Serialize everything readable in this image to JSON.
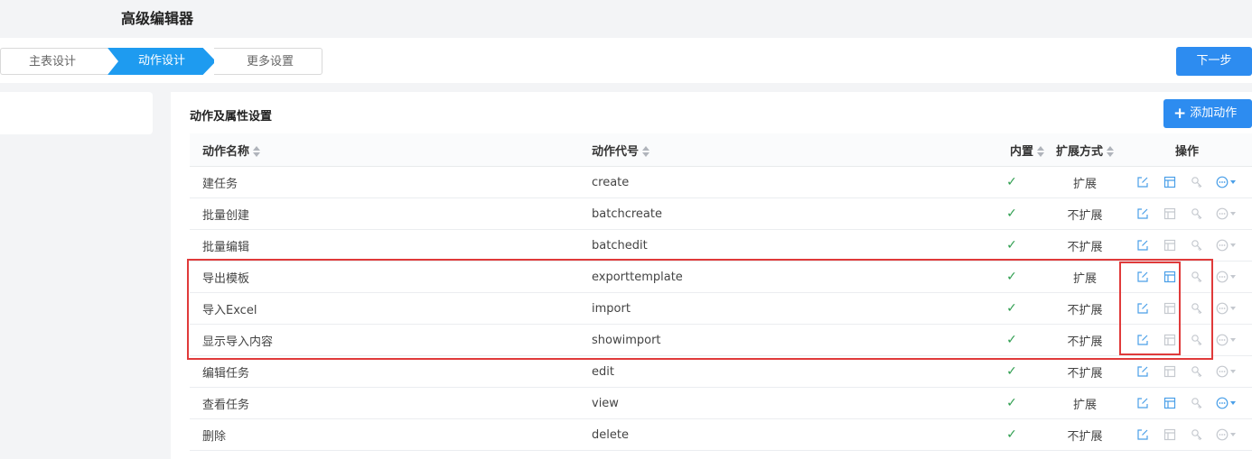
{
  "app_title": "高级编辑器",
  "steps": [
    "主表设计",
    "动作设计",
    "更多设置"
  ],
  "next_button": "下一步",
  "section_title": "动作及属性设置",
  "add_button": "添加动作",
  "columns": {
    "name": "动作名称",
    "code": "动作代号",
    "builtin": "内置",
    "ext": "扩展方式",
    "ops": "操作"
  },
  "rows": [
    {
      "name": "建任务",
      "code": "create",
      "builtin": "✓",
      "ext": "扩展",
      "edit_active": true,
      "layout_active": true,
      "more_active": true
    },
    {
      "name": "批量创建",
      "code": "batchcreate",
      "builtin": "✓",
      "ext": "不扩展",
      "edit_active": true,
      "layout_active": false,
      "more_active": false
    },
    {
      "name": "批量编辑",
      "code": "batchedit",
      "builtin": "✓",
      "ext": "不扩展",
      "edit_active": true,
      "layout_active": false,
      "more_active": false
    },
    {
      "name": "导出模板",
      "code": "exporttemplate",
      "builtin": "✓",
      "ext": "扩展",
      "edit_active": true,
      "layout_active": true,
      "more_active": false
    },
    {
      "name": "导入Excel",
      "code": "import",
      "builtin": "✓",
      "ext": "不扩展",
      "edit_active": true,
      "layout_active": false,
      "more_active": false
    },
    {
      "name": "显示导入内容",
      "code": "showimport",
      "builtin": "✓",
      "ext": "不扩展",
      "edit_active": true,
      "layout_active": false,
      "more_active": false
    },
    {
      "name": "编辑任务",
      "code": "edit",
      "builtin": "✓",
      "ext": "不扩展",
      "edit_active": true,
      "layout_active": false,
      "more_active": false
    },
    {
      "name": "查看任务",
      "code": "view",
      "builtin": "✓",
      "ext": "扩展",
      "edit_active": true,
      "layout_active": true,
      "more_active": true
    },
    {
      "name": "删除",
      "code": "delete",
      "builtin": "✓",
      "ext": "不扩展",
      "edit_active": true,
      "layout_active": false,
      "more_active": false
    }
  ],
  "colors": {
    "primary": "#2d8cf0",
    "step_active": "#1e9bf0",
    "highlight": "#e03a3a",
    "check": "#2e9e4f",
    "icon_active": "#4a9fe8",
    "icon_inactive": "#c5c9cf"
  }
}
